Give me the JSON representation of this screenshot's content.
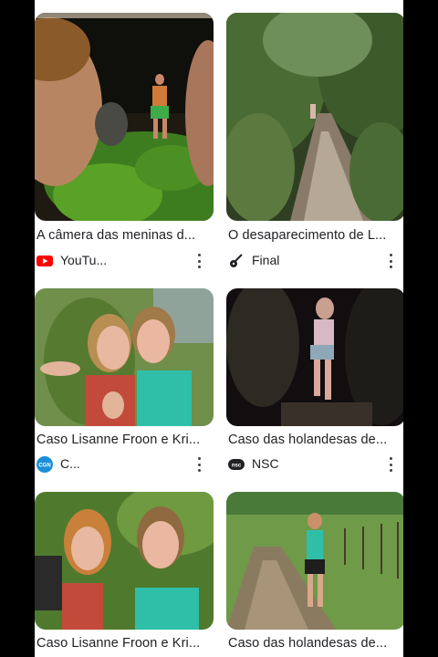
{
  "results": [
    {
      "title": "A câmera das meninas d...",
      "source": "YouTu...",
      "source_icon": "youtube-icon",
      "thumbnail": "selfie-two-girls-jungle"
    },
    {
      "title": "O desaparecimento de L...",
      "source": "Final",
      "source_icon": "guitar-icon",
      "thumbnail": "jungle-trail-night"
    },
    {
      "title": "Caso Lisanne Froon e Kri...",
      "source": "C...",
      "source_icon": "cgn-icon",
      "thumbnail": "two-women-thumbs-up"
    },
    {
      "title": "Caso das holandesas de...",
      "source": "NSC",
      "source_icon": "nsc-icon",
      "thumbnail": "woman-dark-forest"
    },
    {
      "title": "Caso Lisanne Froon e Kri...",
      "source": "",
      "source_icon": "",
      "thumbnail": "two-women-smiling"
    },
    {
      "title": "Caso das holandesas de...",
      "source": "",
      "source_icon": "",
      "thumbnail": "woman-on-dirt-road"
    }
  ],
  "colors": {
    "youtube_red": "#ff0000",
    "cgn_blue": "#1a8fd8",
    "text": "#202124"
  }
}
